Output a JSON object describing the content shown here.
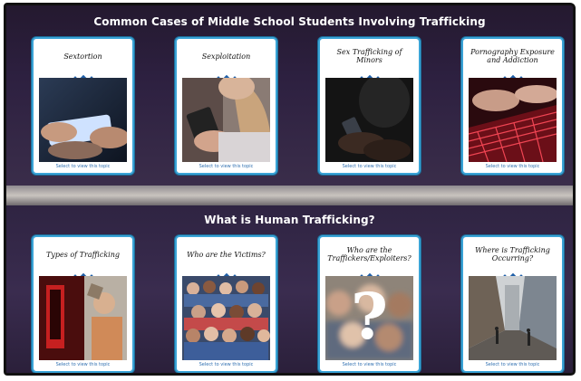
{
  "sections": [
    {
      "heading": "Common Cases of Middle School Students Involving Trafficking",
      "cards": [
        {
          "title": "Sextortion",
          "link": "Select to view this topic"
        },
        {
          "title": "Sexploitation",
          "link": "Select to view this topic"
        },
        {
          "title": "Sex Trafficking of Minors",
          "link": "Select to view this topic"
        },
        {
          "title": "Pornography Exposure and Addiction",
          "link": "Select to view this topic"
        }
      ]
    },
    {
      "heading": "What is Human Trafficking?",
      "cards": [
        {
          "title": "Types of Trafficking",
          "link": "Select to view this topic"
        },
        {
          "title": "Who are the Victims?",
          "link": "Select to view this topic"
        },
        {
          "title": "Who are the Traffickers/Exploiters?",
          "link": "Select to view this topic"
        },
        {
          "title": "Where is Trafficking Occurring?",
          "link": "Select to view this topic"
        }
      ]
    }
  ],
  "colors": {
    "card_border": "#3aa3d6",
    "diamond": "#1f5fa8",
    "link": "#2f6fb0",
    "background": "#2a1d3b"
  }
}
